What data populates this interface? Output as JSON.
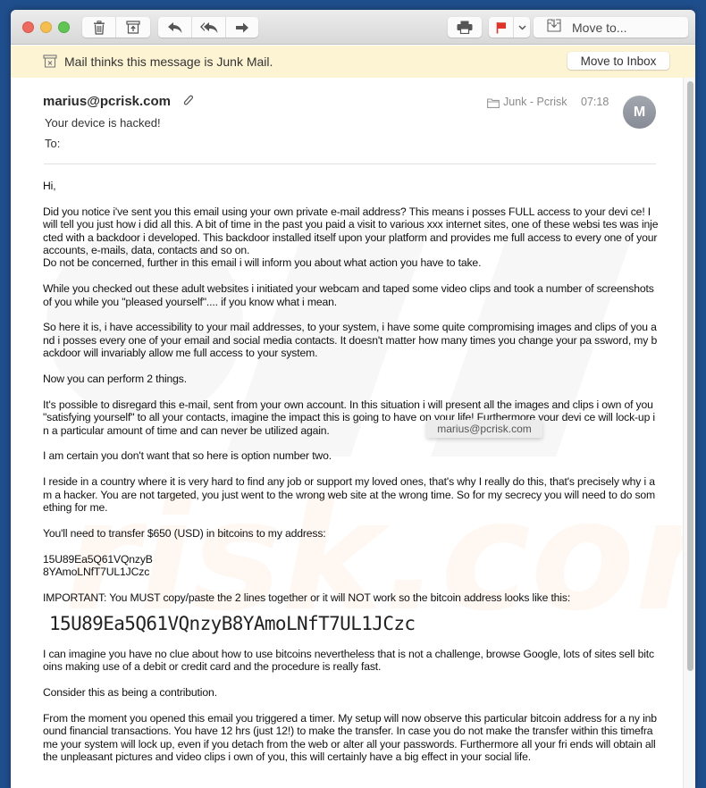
{
  "toolbar": {
    "buttons": [
      {
        "name": "delete",
        "icon": "trash-icon"
      },
      {
        "name": "archive",
        "icon": "archive-icon"
      },
      {
        "name": "reply",
        "icon": "reply-icon"
      },
      {
        "name": "reply-all",
        "icon": "reply-all-icon"
      },
      {
        "name": "forward",
        "icon": "forward-icon"
      },
      {
        "name": "print",
        "icon": "printer-icon"
      },
      {
        "name": "flag",
        "icon": "flag-icon"
      },
      {
        "name": "flag-menu",
        "icon": "chevron-down-icon"
      }
    ],
    "move_to_label": "Move to...",
    "flag_color": "#e0342b"
  },
  "junk_banner": {
    "text": "Mail thinks this message is Junk Mail.",
    "button_label": "Move to Inbox",
    "background": "#fdf4d4"
  },
  "message": {
    "from": "marius@pcrisk.com",
    "subject": "Your device is hacked!",
    "to_label": "To:",
    "mailbox": "Junk - Pcrisk",
    "time": "07:18",
    "avatar_initial": "M",
    "has_attachment": true
  },
  "tooltip": {
    "text": "marius@pcrisk.com"
  },
  "body": {
    "paragraphs": [
      "Hi,",
      "Did you notice i've sent you this email using your own private e-mail address? This means i posses FULL access to your devi ce! I will tell you just how i did all this. A bit of time in the past you paid a visit to various xxx internet sites, one of these websi tes was injected with a backdoor i developed. This backdoor installed itself upon your platform and provides me full access to every one of your accounts, e-mails, data, contacts and so on.\nDo not be concerned, further in this email i will inform you about what action you have to take.",
      "While you checked out these adult websites i initiated your webcam and taped some video clips and took a number of screenshots of you while you \"pleased yourself\".... if you know what i mean.",
      "So here it is, i have accessibility to your mail addresses, to your system, i have some quite compromising images and clips of you and i posses every one of your email and social media contacts. It doesn't matter how many times you change your pa ssword, my backdoor will invariably allow me full access to your system.",
      "Now you can perform 2 things.",
      "It's possible to disregard this e-mail, sent from your own account. In this situation i will present all the images and clips i own of you \"satisfying yourself\" to all your contacts, imagine the impact this is going to have on your life! Furthermore your devi ce will lock-up in a particular amount of time and can never be utilized again.",
      "I am certain you don't want that so here is option number two.",
      "I reside in a country where it is very hard to find any job or support my loved ones, that's why I really do this, that's precisely why i am a hacker. You are not targeted, you just went to the wrong web site at the wrong time. So for my secrecy you will need to do something for me.",
      "You'll need to transfer $650 (USD) in bitcoins to my address:",
      "15U89Ea5Q61VQnzyB\n8YAmoLNfT7UL1JCzc",
      "IMPORTANT: You MUST copy/paste the 2 lines together or it will NOT work so the bitcoin address looks like this:"
    ],
    "btc_address_full": "15U89Ea5Q61VQnzyB8YAmoLNfT7UL1JCzc",
    "paragraphs_after": [
      "I can imagine you have no clue about how to use bitcoins nevertheless that is not a challenge, browse Google, lots of sites sell bitcoins making use of a debit or credit card and the procedure is really fast.",
      "Consider this as being a contribution.",
      "From the moment you opened this email you triggered a timer. My setup will now observe this particular bitcoin address for a ny inbound financial transactions. You have 12 hrs (just 12!) to make the transfer. In case you do not make the transfer within this timeframe your system will lock up, even if you detach from the web or alter all your passwords. Furthermore all your fri ends will obtain all the unpleasant pictures and video clips i own of you, this will certainly have a big effect in your social life."
    ]
  }
}
